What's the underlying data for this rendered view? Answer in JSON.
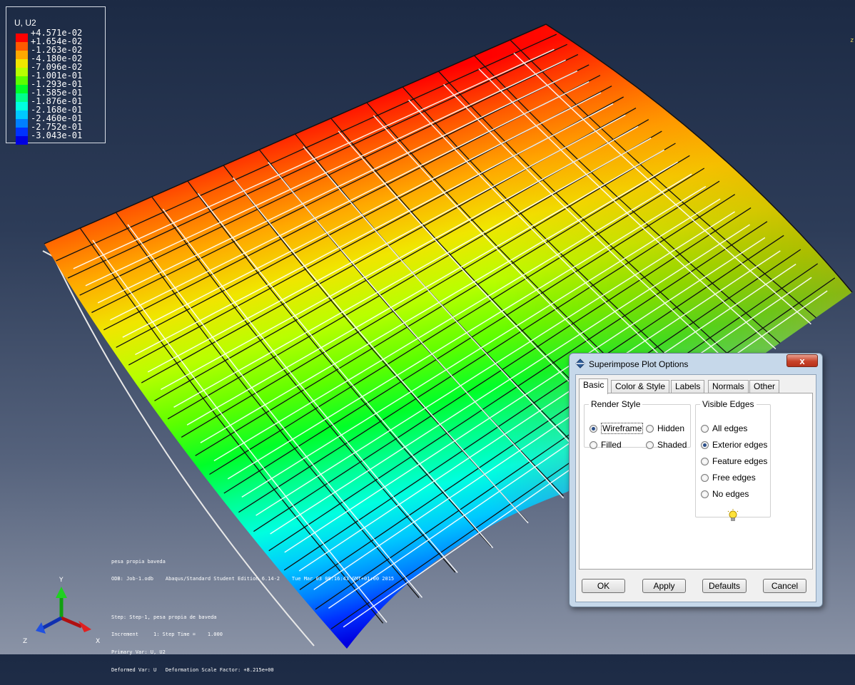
{
  "legend": {
    "title": "U, U2",
    "labels": [
      "+4.571e-02",
      "+1.654e-02",
      "-1.263e-02",
      "-4.180e-02",
      "-7.096e-02",
      "-1.001e-01",
      "-1.293e-01",
      "-1.585e-01",
      "-1.876e-01",
      "-2.168e-01",
      "-2.460e-01",
      "-2.752e-01",
      "-3.043e-01"
    ],
    "colors": [
      "#ff0000",
      "#ff5a00",
      "#ffa800",
      "#f0e600",
      "#b8ff00",
      "#5cff00",
      "#00ff28",
      "#00ff8c",
      "#00ffe0",
      "#00c8ff",
      "#0080ff",
      "#0032ff",
      "#0000e0"
    ]
  },
  "job_info": {
    "line1": "pesa propia baveda",
    "line2": "ODB: Job-1.odb    Abaqus/Standard Student Edition 6.14-2    Tue Mar 03 08:16:43 GMT+01:00 2015"
  },
  "step_info": {
    "line1": "Step: Step-1, pesa propia de baveda",
    "line2": "Increment     1: Step Time =    1.000",
    "line3": "Primary Var: U, U2",
    "line4": "Deformed Var: U   Deformation Scale Factor: +8.215e+00"
  },
  "triad": {
    "x": "X",
    "y": "Y",
    "z": "Z"
  },
  "corner_mark": "z",
  "dialog": {
    "title": "Superimpose Plot Options",
    "close": "x",
    "tabs": [
      "Basic",
      "Color & Style",
      "Labels",
      "Normals",
      "Other"
    ],
    "render_style": {
      "legend": "Render Style",
      "wireframe": "Wireframe",
      "hidden": "Hidden",
      "filled": "Filled",
      "shaded": "Shaded",
      "selected": "Wireframe"
    },
    "visible_edges": {
      "legend": "Visible Edges",
      "options": [
        "All edges",
        "Exterior edges",
        "Feature edges",
        "Free edges",
        "No edges"
      ],
      "selected": "Exterior edges"
    },
    "buttons": {
      "ok": "OK",
      "apply": "Apply",
      "defaults": "Defaults",
      "cancel": "Cancel"
    }
  }
}
